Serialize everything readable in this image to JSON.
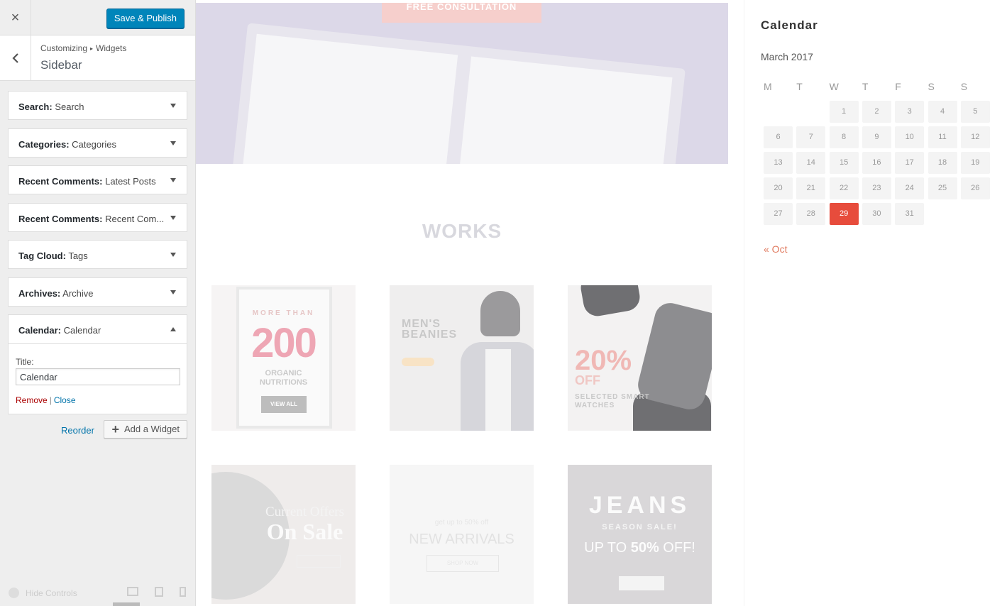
{
  "customizer": {
    "close_label": "×",
    "publish_label": "Save & Publish",
    "breadcrumb": {
      "root": "Customizing",
      "sep": "▸",
      "current": "Widgets"
    },
    "section_title": "Sidebar",
    "widgets": [
      {
        "type": "Search:",
        "title": "Search"
      },
      {
        "type": "Categories:",
        "title": "Categories"
      },
      {
        "type": "Recent Comments:",
        "title": "Latest Posts"
      },
      {
        "type": "Recent Comments:",
        "title": "Recent Com..."
      },
      {
        "type": "Tag Cloud:",
        "title": "Tags"
      },
      {
        "type": "Archives:",
        "title": "Archive"
      }
    ],
    "open_widget": {
      "type": "Calendar:",
      "title": "Calendar",
      "field_label": "Title:",
      "field_value": "Calendar",
      "remove_label": "Remove",
      "pipe": "|",
      "close_label": "Close"
    },
    "reorder_label": "Reorder",
    "add_widget_label": "Add a Widget",
    "hide_controls_label": "Hide Controls"
  },
  "preview": {
    "hero_button": "FREE CONSULTATION",
    "works_title": "WORKS",
    "tiles": {
      "t1": {
        "more": "MORE THAN",
        "big": "200",
        "org1": "ORGANIC",
        "org2": "NUTRITIONS",
        "cta": "VIEW ALL"
      },
      "t2": {
        "line1": "MEN'S",
        "line2": "BEANIES"
      },
      "t3": {
        "pct": "20%",
        "off": "OFF",
        "sel1": "SELECTED SMART",
        "sel2": "WATCHES"
      },
      "t4": {
        "line1": "Current Offers",
        "line2": "On Sale"
      },
      "t5": {
        "line1": "get up to 50% off",
        "line2": "NEW ARRIVALS",
        "cta": "SHOP NOW"
      },
      "t6": {
        "line1": "JEANS",
        "line2": "SEASON SALE!",
        "line3a": "UP TO ",
        "line3b": "50%",
        "line3c": " OFF!"
      }
    }
  },
  "calendar": {
    "title": "Calendar",
    "month": "March 2017",
    "weekdays": [
      "M",
      "T",
      "W",
      "T",
      "F",
      "S",
      "S"
    ],
    "first_weekday_index": 2,
    "days_in_month": 31,
    "today": 29,
    "prev_link": "« Oct",
    "today_color": "#e74c3c"
  }
}
